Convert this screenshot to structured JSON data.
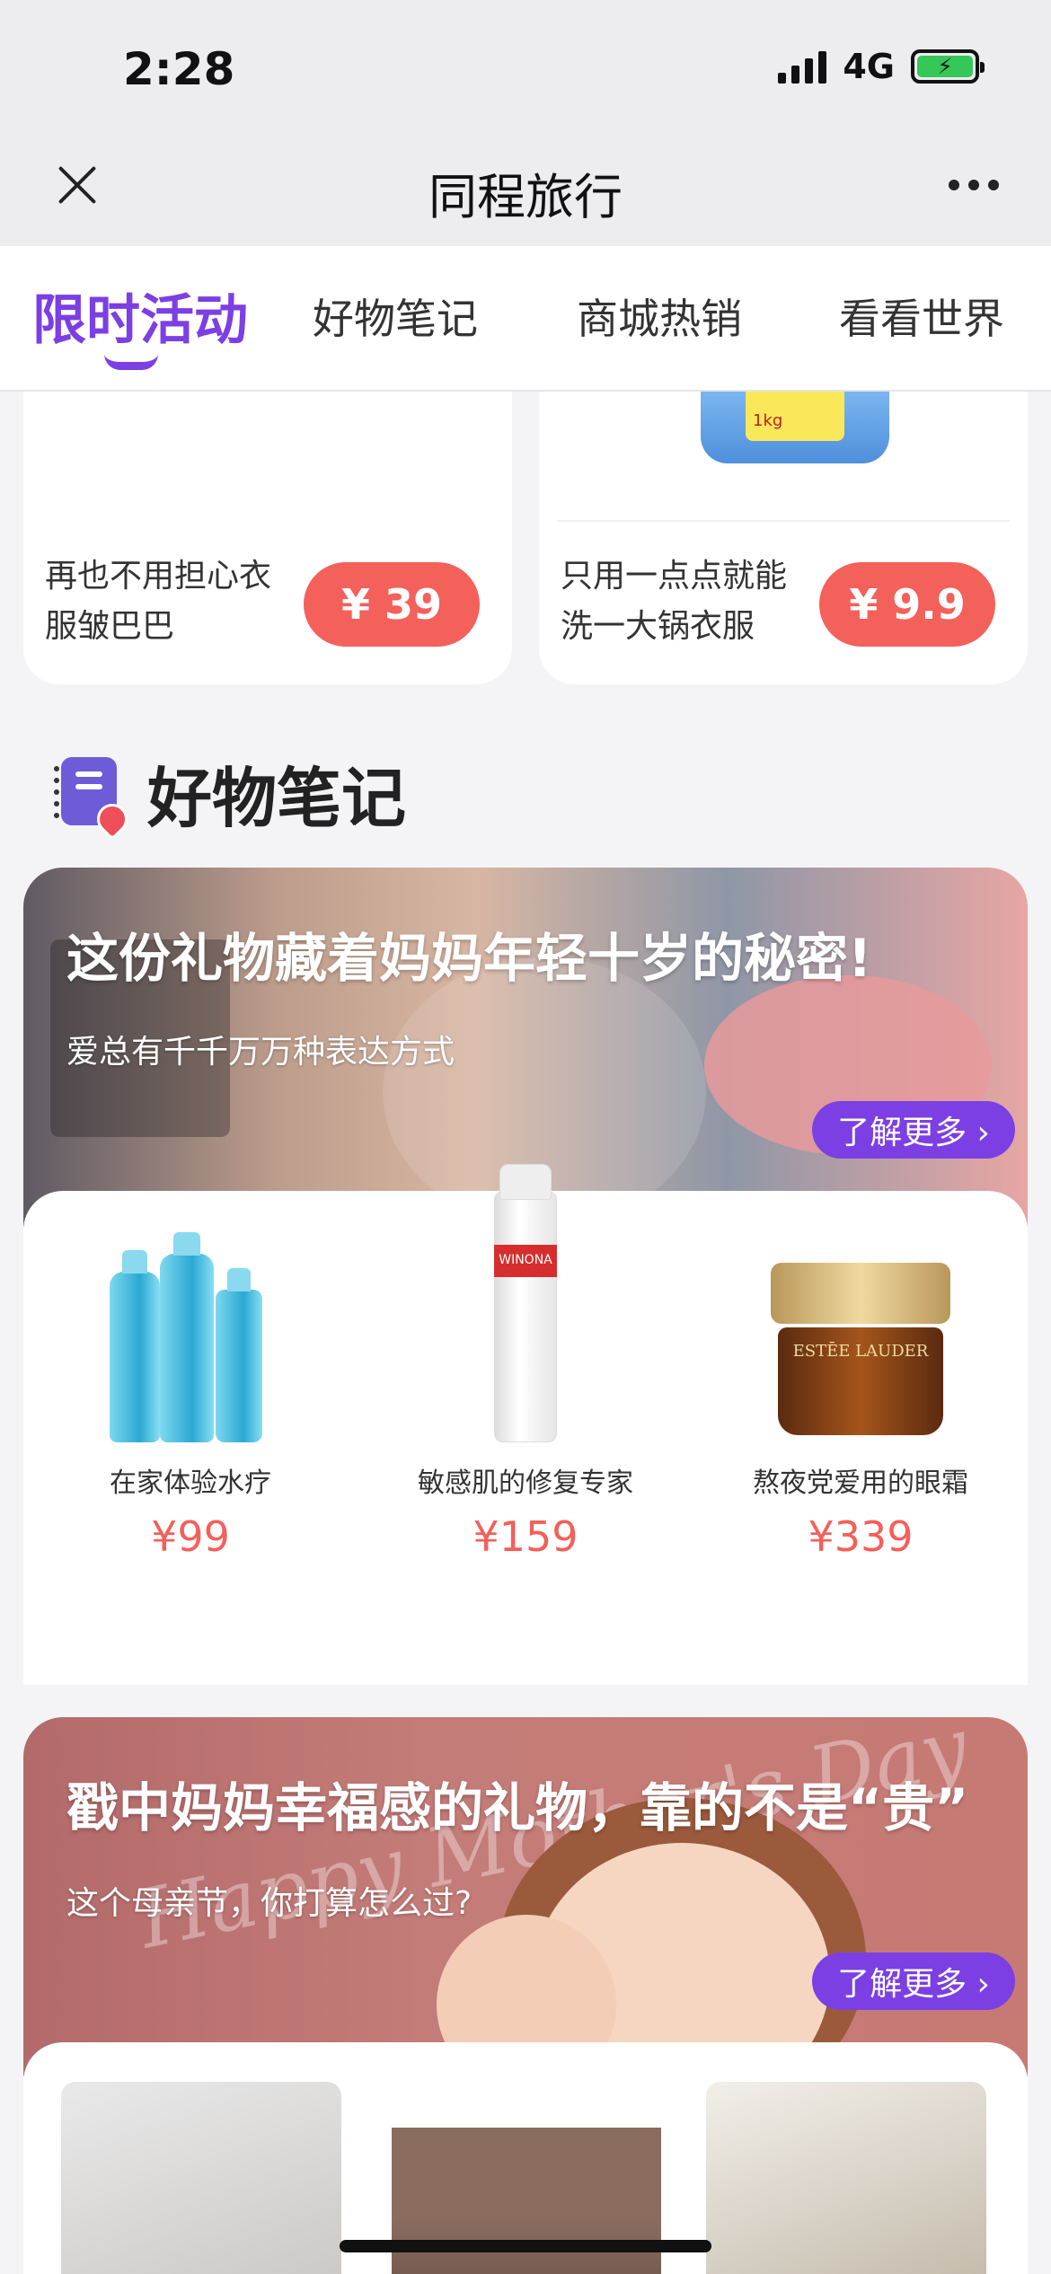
{
  "status": {
    "time": "2:28",
    "network": "4G"
  },
  "nav": {
    "title": "同程旅行"
  },
  "tabs": [
    {
      "label": "限时活动",
      "active": true
    },
    {
      "label": "好物笔记",
      "active": false
    },
    {
      "label": "商城热销",
      "active": false
    },
    {
      "label": "看看世界",
      "active": false
    }
  ],
  "top_products": [
    {
      "desc": "再也不用担心衣服皱巴巴",
      "price": "¥ 39"
    },
    {
      "desc": "只用一点点就能洗一大锅衣服",
      "price": "¥ 9.9",
      "thumb_label": "1kg"
    }
  ],
  "section": {
    "title": "好物笔记"
  },
  "banner1": {
    "title": "这份礼物藏着妈妈年轻十岁的秘密!",
    "subtitle": "爱总有千千万万种表达方式",
    "more": "了解更多 ›"
  },
  "products1": [
    {
      "name": "在家体验水疗",
      "price": "¥99"
    },
    {
      "name": "敏感肌的修复专家",
      "price": "¥159",
      "brand": "WINONA"
    },
    {
      "name": "熬夜党爱用的眼霜",
      "price": "¥339",
      "brand": "ESTĒE LAUDER"
    }
  ],
  "banner2": {
    "title": "戳中妈妈幸福感的礼物，靠的不是“贵”",
    "subtitle": "这个母亲节，你打算怎么过?",
    "more": "了解更多 ›",
    "script": "Happy Mother's Day"
  },
  "colors": {
    "accent": "#7b3fe4",
    "price": "#f4605a"
  }
}
